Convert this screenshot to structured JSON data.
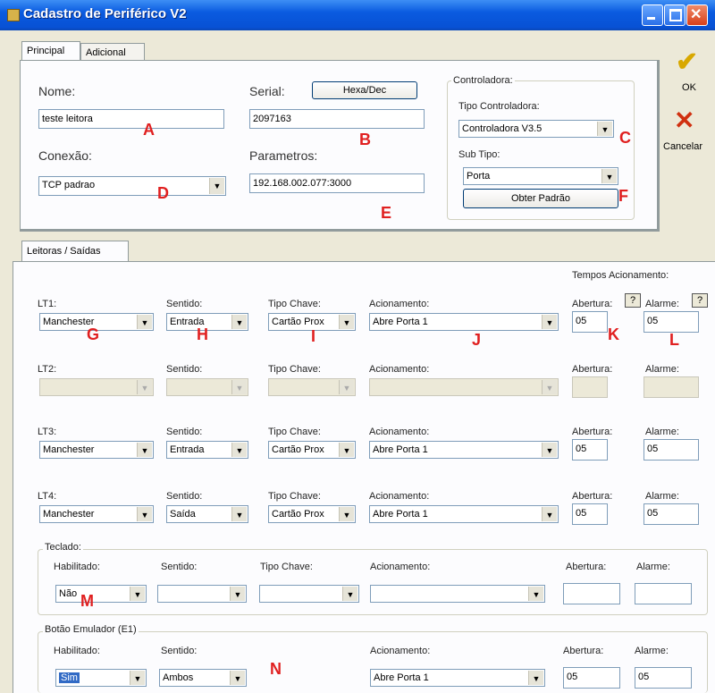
{
  "window": {
    "title": "Cadastro de Periférico V2"
  },
  "tabs": [
    {
      "label": "Principal"
    },
    {
      "label": "Adicional"
    }
  ],
  "side": {
    "ok": "OK",
    "cancel": "Cancelar"
  },
  "colors": {
    "titlebar": "#0a5be0",
    "marker": "#e02020",
    "selection": "#316ac5"
  },
  "principal": {
    "nome_label": "Nome:",
    "nome_value": "teste leitora",
    "serial_label": "Serial:",
    "serial_value": "2097163",
    "hexa_button": "Hexa/Dec",
    "conexao_label": "Conexão:",
    "conexao_value": "TCP padrao",
    "parametros_label": "Parametros:",
    "parametros_value": "192.168.002.077:3000",
    "controladora": {
      "legend": "Controladora:",
      "tipo_label": "Tipo Controladora:",
      "tipo_value": "Controladora V3.5",
      "subtipo_label": "Sub Tipo:",
      "subtipo_value": "Porta",
      "obter_button": "Obter Padrão"
    }
  },
  "leitoras": {
    "tab": "Leitoras / Saídas",
    "tempos": "Tempos Acionamento:",
    "help": "?",
    "rows": [
      {
        "name": "LT1:",
        "sentido_label": "Sentido:",
        "tipo_label": "Tipo Chave:",
        "acion_label": "Acionamento:",
        "abertura_label": "Abertura:",
        "alarme_label": "Alarme:",
        "leitor": "Manchester",
        "sentido": "Entrada",
        "tipo": "Cartão Prox",
        "acion": "Abre Porta 1",
        "abertura": "05",
        "alarme": "05"
      },
      {
        "name": "LT2:",
        "sentido_label": "Sentido:",
        "tipo_label": "Tipo Chave:",
        "acion_label": "Acionamento:",
        "abertura_label": "Abertura:",
        "alarme_label": "Alarme:",
        "leitor": "",
        "sentido": "",
        "tipo": "",
        "acion": "",
        "abertura": "",
        "alarme": ""
      },
      {
        "name": "LT3:",
        "sentido_label": "Sentido:",
        "tipo_label": "Tipo Chave:",
        "acion_label": "Acionamento:",
        "abertura_label": "Abertura:",
        "alarme_label": "Alarme:",
        "leitor": "Manchester",
        "sentido": "Entrada",
        "tipo": "Cartão Prox",
        "acion": "Abre Porta 1",
        "abertura": "05",
        "alarme": "05"
      },
      {
        "name": "LT4:",
        "sentido_label": "Sentido:",
        "tipo_label": "Tipo Chave:",
        "acion_label": "Acionamento:",
        "abertura_label": "Abertura:",
        "alarme_label": "Alarme:",
        "leitor": "Manchester",
        "sentido": "Saída",
        "tipo": "Cartão Prox",
        "acion": "Abre Porta 1",
        "abertura": "05",
        "alarme": "05"
      }
    ],
    "teclado": {
      "legend": "Teclado:",
      "habilitado_label": "Habilitado:",
      "sentido_label": "Sentido:",
      "tipo_label": "Tipo Chave:",
      "acion_label": "Acionamento:",
      "abertura_label": "Abertura:",
      "alarme_label": "Alarme:",
      "habilitado": "Não",
      "sentido": "",
      "tipo": "",
      "acion": "",
      "abertura": "",
      "alarme": ""
    },
    "botao": {
      "legend": "Botão Emulador (E1)",
      "habilitado_label": "Habilitado:",
      "sentido_label": "Sentido:",
      "acion_label": "Acionamento:",
      "abertura_label": "Abertura:",
      "alarme_label": "Alarme:",
      "habilitado": "Sim",
      "sentido": "Ambos",
      "acion": "Abre Porta 1",
      "abertura": "05",
      "alarme": "05"
    }
  },
  "markers": {
    "A": "A",
    "B": "B",
    "C": "C",
    "D": "D",
    "E": "E",
    "F": "F",
    "G": "G",
    "H": "H",
    "I": "I",
    "J": "J",
    "K": "K",
    "L": "L",
    "M": "M",
    "N": "N"
  }
}
